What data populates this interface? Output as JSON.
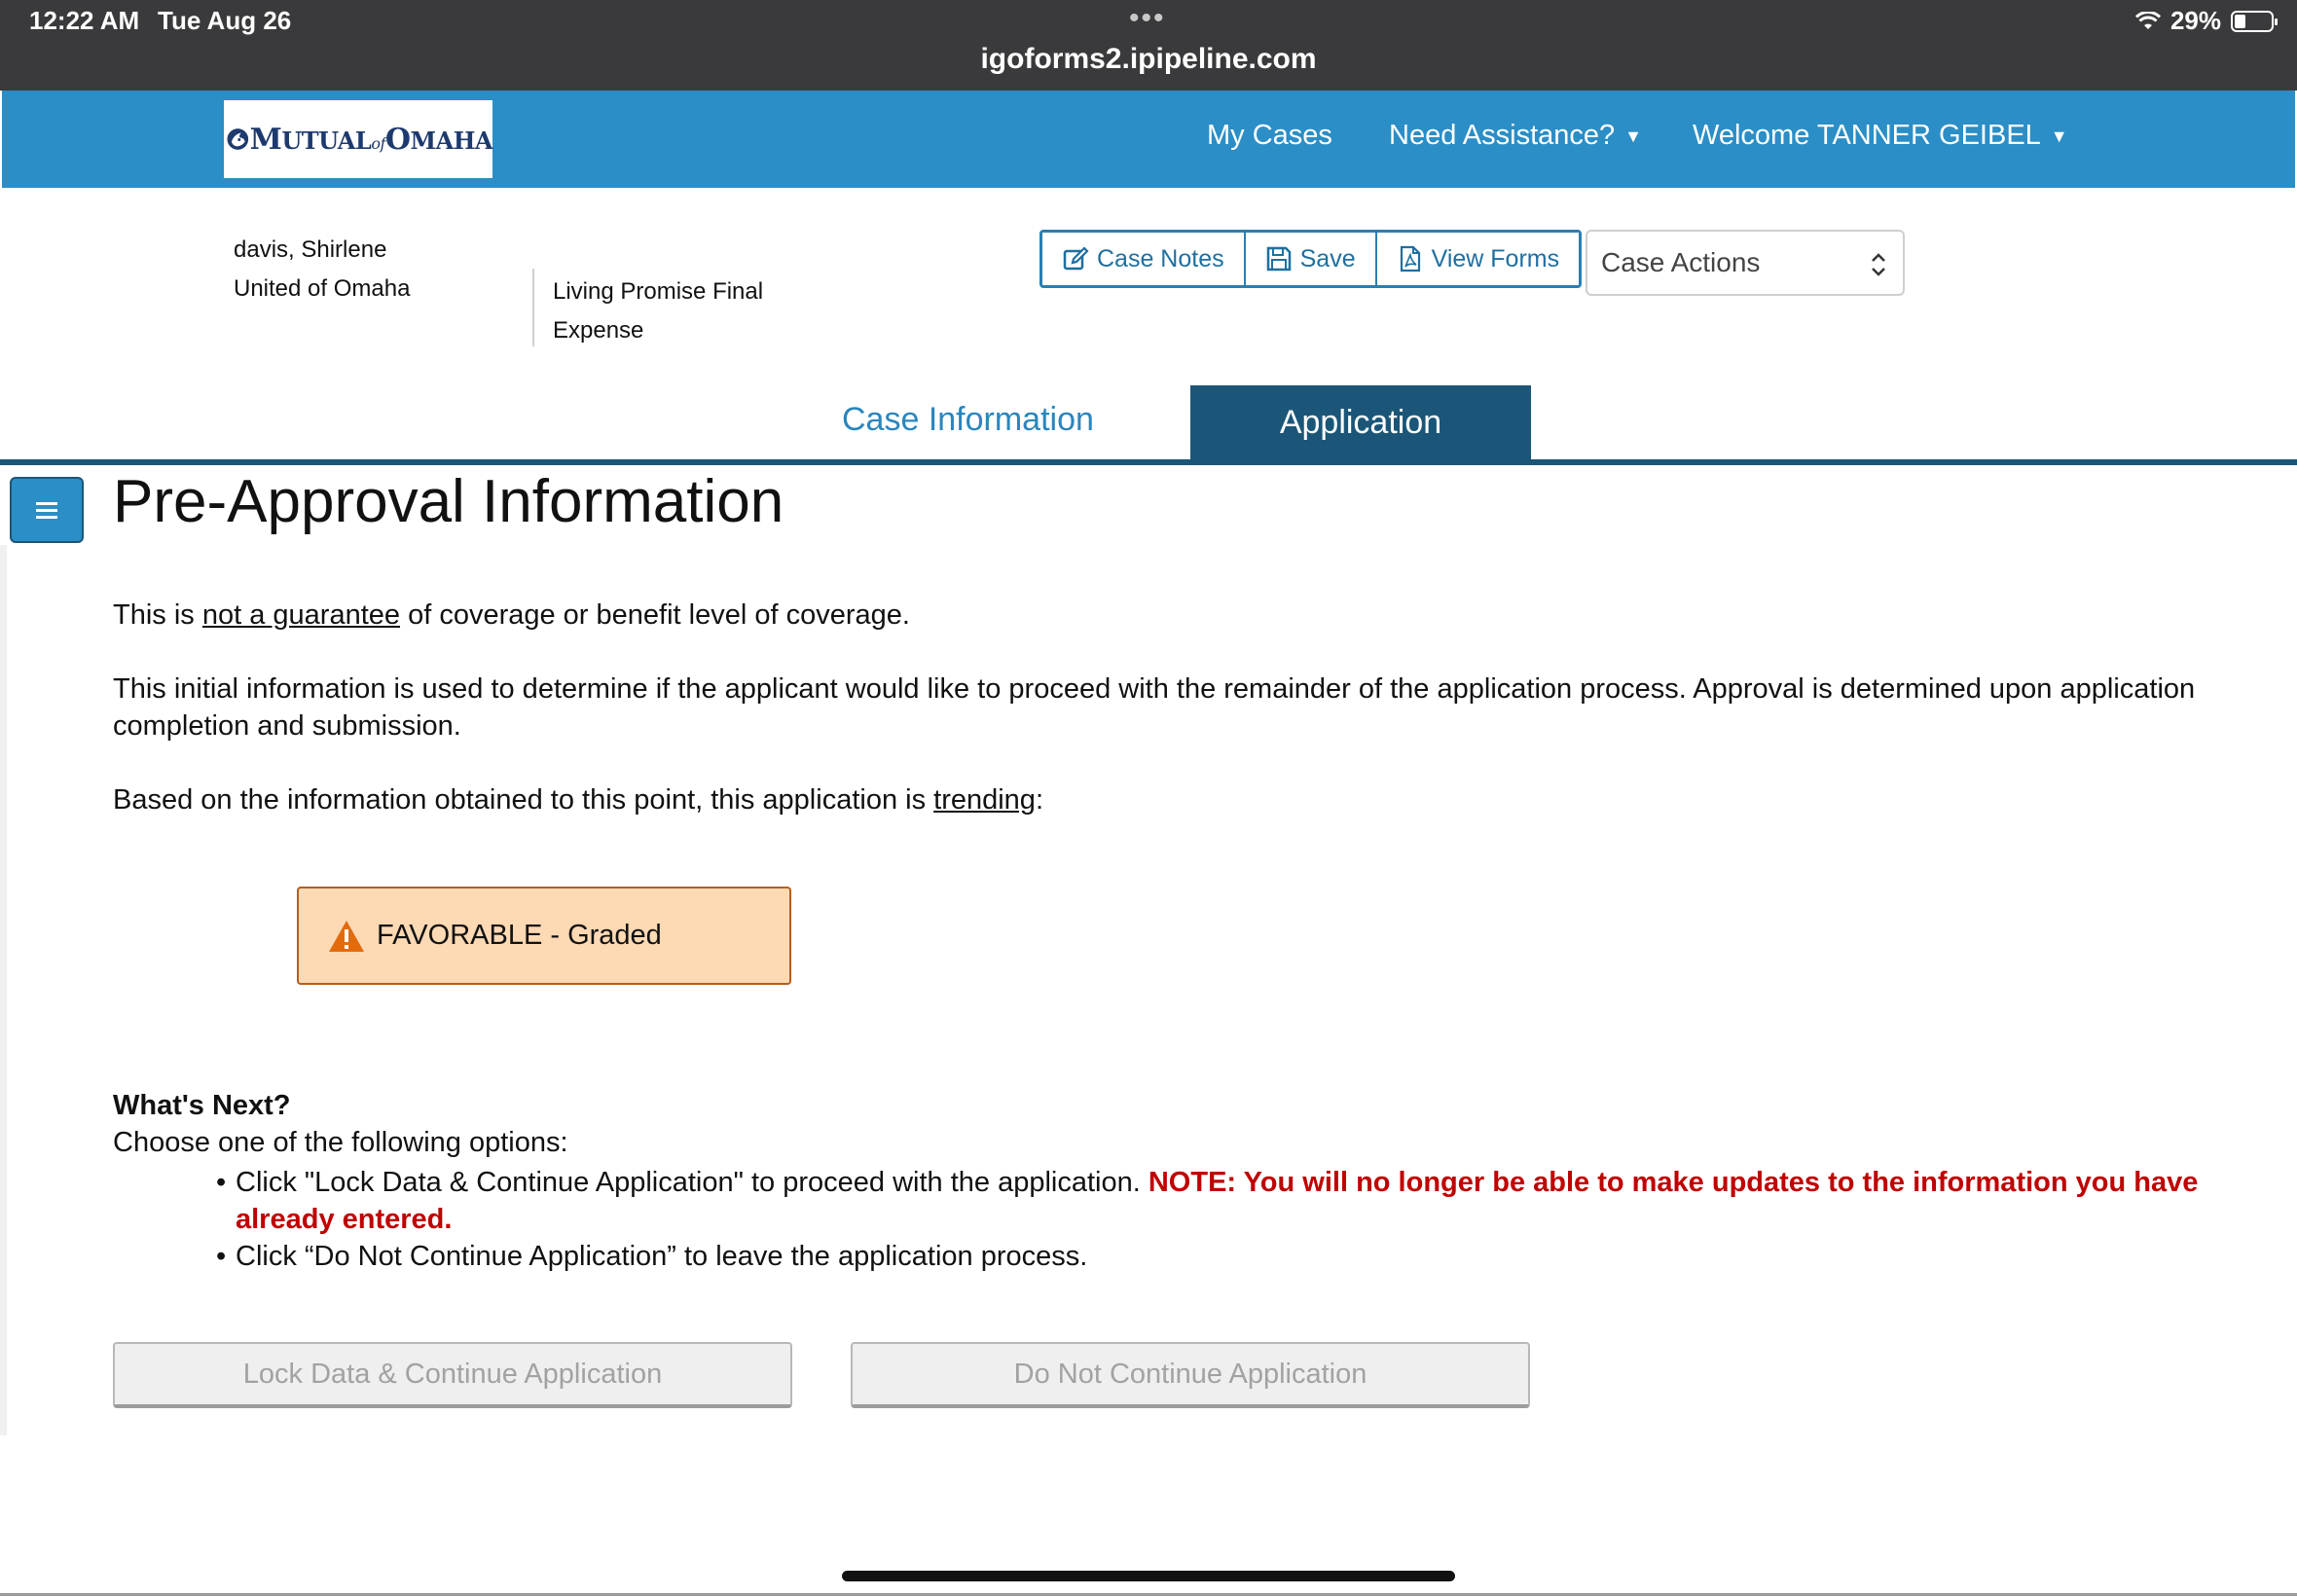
{
  "statusbar": {
    "time": "12:22 AM",
    "date": "Tue Aug 26",
    "dots": "•••",
    "url": "igoforms2.ipipeline.com",
    "battery": "29%"
  },
  "header": {
    "logo_text": "MUTUAL of OMAHA",
    "nav_my_cases": "My Cases",
    "nav_assistance": "Need Assistance?",
    "nav_welcome": "Welcome",
    "nav_user": "TANNER GEIBEL"
  },
  "case": {
    "client_name": "davis, Shirlene",
    "company": "United of Omaha",
    "product": "Living Promise Final Expense",
    "btn_notes": "Case Notes",
    "btn_save": "Save",
    "btn_forms": "View Forms",
    "actions_label": "Case Actions"
  },
  "tabs": {
    "case_info": "Case Information",
    "application": "Application"
  },
  "content": {
    "title": "Pre-Approval Information",
    "p1_a": "This is ",
    "p1_u": "not a guarantee",
    "p1_b": " of coverage or benefit level of coverage.",
    "p2": "This initial information is used to determine if the applicant would like to proceed with the remainder of the application process. Approval is determined upon application completion and submission.",
    "p3_a": "Based on the information obtained to this point, this application is ",
    "p3_u": "trending",
    "p3_b": ":",
    "status": "FAVORABLE - Graded",
    "status_color": "#fdd9b4",
    "next_title": "What's Next?",
    "next_sub": "Choose one of the following options:",
    "bullet1": "Click \"Lock Data & Continue Application\" to proceed with the application.",
    "bullet1_note": "NOTE: You will no longer be able to make updates to the information you have already entered.",
    "bullet2": "Click “Do Not Continue Application” to leave the application process.",
    "btn_lock": "Lock Data & Continue Application",
    "btn_no": "Do Not Continue Application"
  }
}
